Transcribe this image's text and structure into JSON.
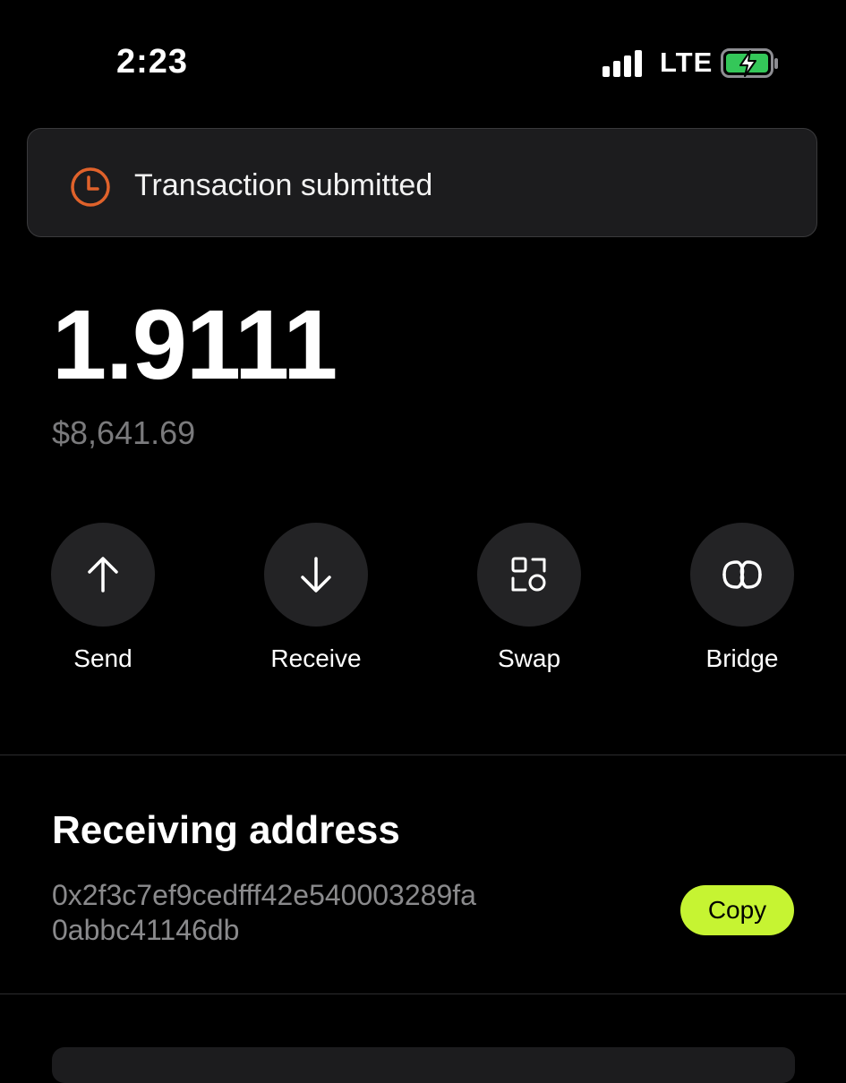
{
  "status_bar": {
    "time": "2:23",
    "network": "LTE"
  },
  "toast": {
    "text": "Transaction submitted",
    "icon": "clock-icon",
    "accent": "#e0622b"
  },
  "balance": {
    "amount": "1.9111",
    "fiat": "$8,641.69"
  },
  "actions": [
    {
      "label": "Send",
      "icon": "arrow-up-icon"
    },
    {
      "label": "Receive",
      "icon": "arrow-down-icon"
    },
    {
      "label": "Swap",
      "icon": "swap-icon"
    },
    {
      "label": "Bridge",
      "icon": "bridge-icon"
    }
  ],
  "receiving": {
    "title": "Receiving address",
    "address_line1": "0x2f3c7ef9cedfff42e540003289fa",
    "address_line2": "0abbc41146db",
    "copy_label": "Copy",
    "copy_color": "#c6f432"
  }
}
